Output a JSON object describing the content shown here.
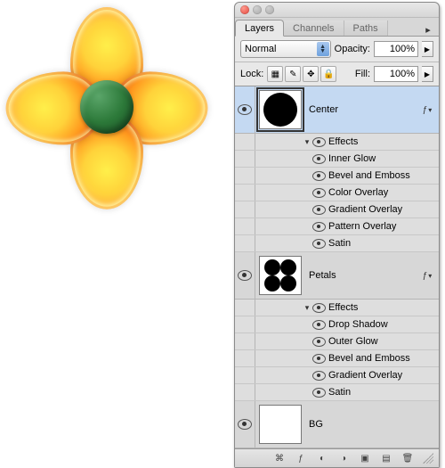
{
  "tabs": {
    "layers": "Layers",
    "channels": "Channels",
    "paths": "Paths"
  },
  "blend": {
    "mode": "Normal",
    "opacity_label": "Opacity:",
    "opacity_value": "100%"
  },
  "lock": {
    "label": "Lock:",
    "fill_label": "Fill:",
    "fill_value": "100%"
  },
  "layers": {
    "center": {
      "name": "Center",
      "effects_label": "Effects",
      "effects": {
        "inner_glow": "Inner Glow",
        "bevel_emboss": "Bevel and Emboss",
        "color_overlay": "Color Overlay",
        "gradient_overlay": "Gradient Overlay",
        "pattern_overlay": "Pattern Overlay",
        "satin": "Satin"
      }
    },
    "petals": {
      "name": "Petals",
      "effects_label": "Effects",
      "effects": {
        "drop_shadow": "Drop Shadow",
        "outer_glow": "Outer Glow",
        "bevel_emboss": "Bevel and Emboss",
        "gradient_overlay": "Gradient Overlay",
        "satin": "Satin"
      }
    },
    "bg": {
      "name": "BG"
    }
  }
}
